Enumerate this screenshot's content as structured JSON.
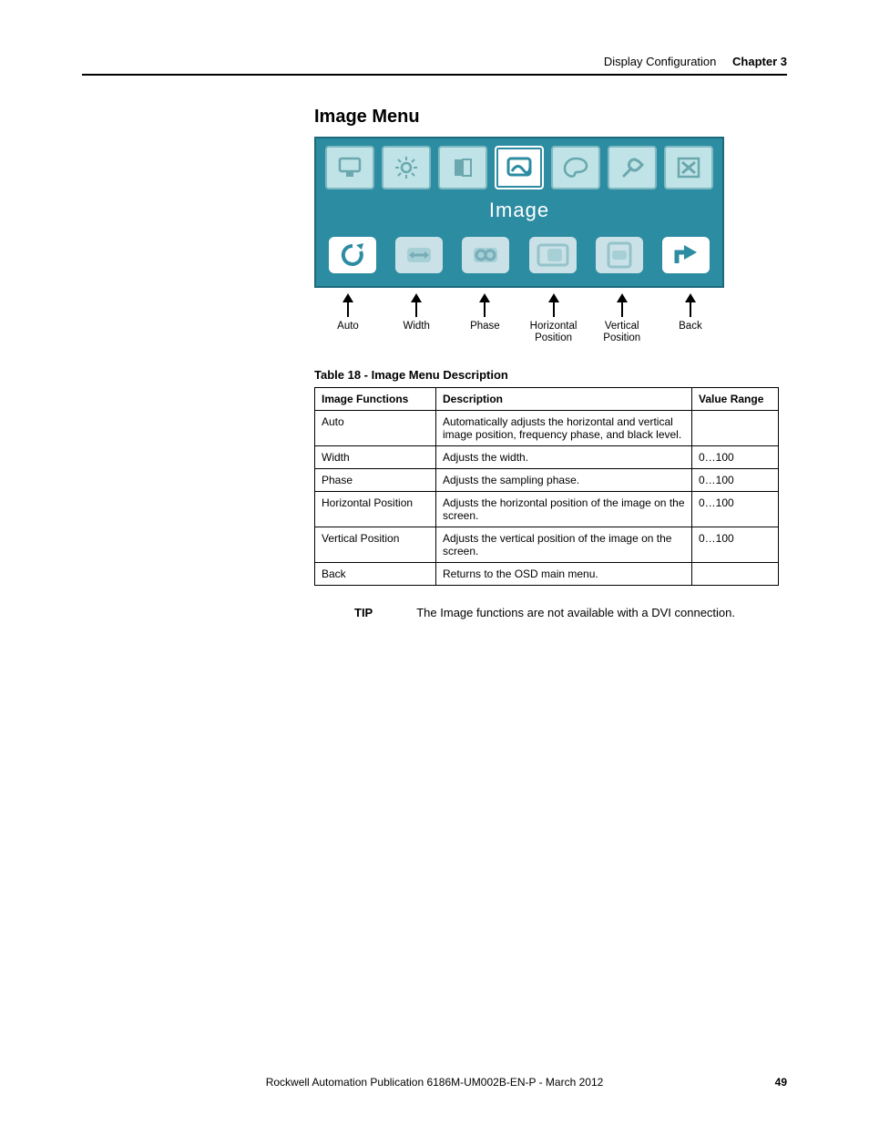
{
  "header": {
    "section": "Display Configuration",
    "chapter": "Chapter 3"
  },
  "section_title": "Image Menu",
  "osd": {
    "title": "Image",
    "top_icons": [
      "monitor",
      "brightness",
      "contrast",
      "image",
      "color",
      "tools",
      "close"
    ],
    "selected_top_index": 3,
    "bottom_icons": [
      {
        "name": "auto",
        "label": "Auto"
      },
      {
        "name": "width",
        "label": "Width"
      },
      {
        "name": "phase",
        "label": "Phase"
      },
      {
        "name": "hpos",
        "label": "Horizontal\nPosition"
      },
      {
        "name": "vpos",
        "label": "Vertical\nPosition"
      },
      {
        "name": "back",
        "label": "Back"
      }
    ]
  },
  "table_title": "Table 18 - Image Menu Description",
  "table": {
    "headers": [
      "Image Functions",
      "Description",
      "Value Range"
    ],
    "rows": [
      [
        "Auto",
        "Automatically adjusts the horizontal and vertical image position, frequency phase, and black level.",
        ""
      ],
      [
        "Width",
        "Adjusts the width.",
        "0…100"
      ],
      [
        "Phase",
        "Adjusts the sampling phase.",
        "0…100"
      ],
      [
        "Horizontal Position",
        "Adjusts the horizontal position of the image on the screen.",
        "0…100"
      ],
      [
        "Vertical Position",
        "Adjusts the vertical position of the image on the screen.",
        "0…100"
      ],
      [
        "Back",
        "Returns to the OSD main menu.",
        ""
      ]
    ]
  },
  "tip": {
    "label": "TIP",
    "text": "The Image functions are not available with a DVI connection."
  },
  "footer": {
    "pub": "Rockwell Automation Publication 6186M-UM002B-EN-P - March 2012",
    "page": "49"
  }
}
